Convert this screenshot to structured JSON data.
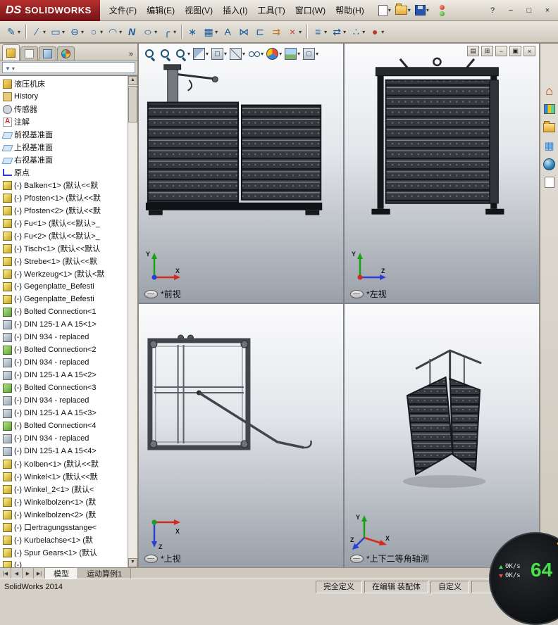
{
  "titlebar": {
    "logo_mark": "DS",
    "logo_text": "SOLIDWORKS",
    "menus": [
      {
        "label": "文件(F)"
      },
      {
        "label": "编辑(E)"
      },
      {
        "label": "视图(V)"
      },
      {
        "label": "插入(I)"
      },
      {
        "label": "工具(T)"
      },
      {
        "label": "窗口(W)"
      },
      {
        "label": "帮助(H)"
      }
    ],
    "qat": [
      {
        "name": "new-document-button",
        "cls": "qi-page",
        "caret": "▾"
      },
      {
        "name": "open-button",
        "cls": "qi-folder",
        "caret": "▾"
      },
      {
        "name": "save-button",
        "cls": "qi-floppy",
        "caret": "▾"
      },
      {
        "name": "record-indicator-icon",
        "cls": "qi-record"
      }
    ],
    "window_buttons": [
      {
        "name": "help-button",
        "glyph": "?"
      },
      {
        "name": "minimize-button",
        "glyph": "−"
      },
      {
        "name": "maximize-button",
        "glyph": "□"
      },
      {
        "name": "close-button",
        "glyph": "×"
      }
    ]
  },
  "sketch_toolbar": [
    {
      "name": "sketch-button",
      "glyph": "✎",
      "caret": "▾"
    },
    {
      "name": "separator",
      "cls": "tsep-item"
    },
    {
      "name": "line-button",
      "glyph": "∕",
      "caret": "▾"
    },
    {
      "name": "rectangle-button",
      "glyph": "▭",
      "caret": "▾"
    },
    {
      "name": "slot-button",
      "glyph": "⊖",
      "caret": "▾"
    },
    {
      "name": "circle-button",
      "glyph": "○",
      "caret": "▾"
    },
    {
      "name": "arc-button",
      "glyph": "◠",
      "caret": "▾"
    },
    {
      "name": "spline-button",
      "glyph": "N",
      "gcls": "g-ital"
    },
    {
      "name": "ellipse-button",
      "glyph": "○",
      "gcls": "g-wide",
      "caret": "▾"
    },
    {
      "name": "sketch-fillet-button",
      "glyph": "╭",
      "caret": "▾"
    },
    {
      "name": "separator",
      "cls": "tsep-item"
    },
    {
      "name": "point-button",
      "glyph": "∗"
    },
    {
      "name": "linear-pattern-button",
      "glyph": "▦",
      "caret": "▾"
    },
    {
      "name": "text-button",
      "glyph": "A"
    },
    {
      "name": "mirror-entities-button",
      "glyph": "⋈"
    },
    {
      "name": "convert-entities-button",
      "glyph": "⊏"
    },
    {
      "name": "offset-entities-button",
      "glyph": "⇉",
      "gcls": "g-orange"
    },
    {
      "name": "trim-entities-button",
      "glyph": "×",
      "gcls": "g-red",
      "caret": "▾"
    },
    {
      "name": "separator",
      "cls": "tsep-item"
    },
    {
      "name": "display-relations-button",
      "glyph": "≡",
      "caret": "▾"
    },
    {
      "name": "move-entities-button",
      "glyph": "⇄",
      "caret": "▾"
    },
    {
      "name": "quick-snaps-button",
      "glyph": "∴",
      "caret": "▾"
    },
    {
      "name": "exit-sketch-button",
      "glyph": "●",
      "gcls": "g-red",
      "caret": "▾"
    }
  ],
  "feature_panel": {
    "tabs": [
      {
        "name": "featuremanager-tab",
        "cls": "pt-tree active"
      },
      {
        "name": "propertymanager-tab",
        "cls": "pt-page"
      },
      {
        "name": "configurationmanager-tab",
        "cls": "pt-config"
      },
      {
        "name": "displaymanager-tab",
        "cls": "pt-ball"
      }
    ],
    "expand_label": "»",
    "tree": [
      {
        "icon": "assembly-icon",
        "cls": "tic-assembly",
        "label": "液压机床"
      },
      {
        "icon": "history-folder-icon",
        "cls": "tic-history",
        "label": "History"
      },
      {
        "icon": "sensors-icon",
        "cls": "tic-sensors",
        "label": "传感器"
      },
      {
        "icon": "annotations-icon",
        "cls": "tic-annotations",
        "label": "注解"
      },
      {
        "icon": "plane-icon",
        "cls": "tic-plane",
        "label": "前视基准面"
      },
      {
        "icon": "plane-icon",
        "cls": "tic-plane",
        "label": "上视基准面"
      },
      {
        "icon": "plane-icon",
        "cls": "tic-plane",
        "label": "右视基准面"
      },
      {
        "icon": "origin-icon",
        "cls": "tic-origin",
        "label": "原点"
      },
      {
        "icon": "part-icon",
        "cls": "tic-part",
        "label": "(-) Balken<1> (默认<<默"
      },
      {
        "icon": "part-icon",
        "cls": "tic-part",
        "label": "(-) Pfosten<1> (默认<<默"
      },
      {
        "icon": "part-icon",
        "cls": "tic-part",
        "label": "(-) Pfosten<2> (默认<<默"
      },
      {
        "icon": "part-icon",
        "cls": "tic-part",
        "label": "(-) Fu<1> (默认<<默认>_"
      },
      {
        "icon": "part-icon",
        "cls": "tic-part",
        "label": "(-) Fu<2> (默认<<默认>_"
      },
      {
        "icon": "part-icon",
        "cls": "tic-part",
        "label": "(-) Tisch<1> (默认<<默认"
      },
      {
        "icon": "part-icon",
        "cls": "tic-part",
        "label": "(-) Strebe<1> (默认<<默"
      },
      {
        "icon": "part-icon",
        "cls": "tic-part",
        "label": "(-) Werkzeug<1> (默认<默"
      },
      {
        "icon": "part-icon",
        "cls": "tic-part",
        "label": "(-) Gegenplatte_Befesti"
      },
      {
        "icon": "part-icon",
        "cls": "tic-part",
        "label": "(-) Gegenplatte_Befesti"
      },
      {
        "icon": "bolted-connection-icon",
        "cls": "tic-bolted",
        "label": "(-) Bolted Connection<1"
      },
      {
        "icon": "fastener-icon",
        "cls": "tic-fastener",
        "label": "(-) DIN 125-1 A A 15<1>"
      },
      {
        "icon": "fastener-icon",
        "cls": "tic-fastener",
        "label": "(-) DIN 934 - replaced "
      },
      {
        "icon": "bolted-connection-icon",
        "cls": "tic-bolted",
        "label": "(-) Bolted Connection<2"
      },
      {
        "icon": "fastener-icon",
        "cls": "tic-fastener",
        "label": "(-) DIN 934 - replaced "
      },
      {
        "icon": "fastener-icon",
        "cls": "tic-fastener",
        "label": "(-) DIN 125-1 A A 15<2>"
      },
      {
        "icon": "bolted-connection-icon",
        "cls": "tic-bolted",
        "label": "(-) Bolted Connection<3"
      },
      {
        "icon": "fastener-icon",
        "cls": "tic-fastener",
        "label": "(-) DIN 934 - replaced "
      },
      {
        "icon": "fastener-icon",
        "cls": "tic-fastener",
        "label": "(-) DIN 125-1 A A 15<3>"
      },
      {
        "icon": "bolted-connection-icon",
        "cls": "tic-bolted",
        "label": "(-) Bolted Connection<4"
      },
      {
        "icon": "fastener-icon",
        "cls": "tic-fastener",
        "label": "(-) DIN 934 - replaced "
      },
      {
        "icon": "fastener-icon",
        "cls": "tic-fastener",
        "label": "(-) DIN 125-1 A A 15<4>"
      },
      {
        "icon": "part-icon",
        "cls": "tic-part",
        "label": "(-) Kolben<1> (默认<<默"
      },
      {
        "icon": "part-icon",
        "cls": "tic-part",
        "label": "(-) Winkel<1> (默认<<默"
      },
      {
        "icon": "part-icon",
        "cls": "tic-part",
        "label": "(-) Winkel_2<1> (默认<"
      },
      {
        "icon": "part-icon",
        "cls": "tic-part",
        "label": "(-) Winkelbolzen<1> (默"
      },
      {
        "icon": "part-icon",
        "cls": "tic-part",
        "label": "(-) Winkelbolzen<2> (默"
      },
      {
        "icon": "part-icon",
        "cls": "tic-part",
        "label": "(-) 口ertragungsstange<"
      },
      {
        "icon": "part-icon",
        "cls": "tic-part",
        "label": "(-) Kurbelachse<1> (默"
      },
      {
        "icon": "part-icon",
        "cls": "tic-part",
        "label": "(-) Spur Gears<1> (默认"
      },
      {
        "icon": "part-icon",
        "cls": "tic-part",
        "label": "(-) "
      }
    ]
  },
  "headsup": [
    {
      "name": "zoom-fit-button",
      "cls": "hi-mag"
    },
    {
      "name": "zoom-area-button",
      "cls": "hi-mag"
    },
    {
      "name": "previous-view-button",
      "cls": "hi-mag",
      "caret": "▾"
    },
    {
      "name": "section-view-button",
      "cls": "hi-section",
      "caret": "▾"
    },
    {
      "name": "view-orientation-button",
      "cls": "hi-cube",
      "caret": "▾"
    },
    {
      "name": "display-style-button",
      "cls": "hi-cube2",
      "caret": "▾"
    },
    {
      "name": "hide-show-items-button",
      "cls": "hi-eye",
      "caret": "▾"
    },
    {
      "name": "edit-appearance-button",
      "cls": "hi-ball",
      "caret": "▾"
    },
    {
      "name": "apply-scene-button",
      "cls": "hi-scene",
      "caret": "▾"
    },
    {
      "name": "view-settings-button",
      "cls": "hi-cube",
      "caret": "▾"
    }
  ],
  "doc_controls": [
    {
      "name": "viewport-layout-button",
      "glyph": "▤"
    },
    {
      "name": "viewport-four-view-button",
      "glyph": "⊞"
    },
    {
      "name": "doc-minimize-button",
      "glyph": "−"
    },
    {
      "name": "doc-restore-button",
      "glyph": "▣"
    },
    {
      "name": "doc-close-button",
      "glyph": "×"
    }
  ],
  "viewports": [
    {
      "label": "*前视"
    },
    {
      "label": "*左视"
    },
    {
      "label": "*上视"
    },
    {
      "label": "*上下二等角轴测"
    }
  ],
  "task_pane": [
    {
      "name": "home-icon",
      "cls": "tp-home",
      "glyph": "⌂"
    },
    {
      "name": "design-library-icon",
      "cls": "tp-lib"
    },
    {
      "name": "file-explorer-icon",
      "cls": "tp-folder"
    },
    {
      "name": "view-palette-icon",
      "cls": "tp-grid",
      "glyph": "▦"
    },
    {
      "name": "appearances-icon",
      "cls": "tp-globe"
    },
    {
      "name": "custom-properties-icon",
      "cls": "tp-props"
    }
  ],
  "bottom_tabs": {
    "nav": [
      {
        "glyph": "|◀"
      },
      {
        "glyph": "◀"
      },
      {
        "glyph": "▶"
      },
      {
        "glyph": "▶|"
      }
    ],
    "tabs": [
      {
        "label": "模型",
        "cls": "active"
      },
      {
        "label": "运动算例1",
        "cls": ""
      }
    ]
  },
  "status_bar": {
    "app": "SolidWorks 2014",
    "fields": [
      {
        "label": "完全定义"
      },
      {
        "label": "在编辑 装配体"
      },
      {
        "label": "自定义"
      }
    ]
  },
  "recorder": {
    "up": "0K/s",
    "down": "0K/s",
    "fps": "64"
  }
}
